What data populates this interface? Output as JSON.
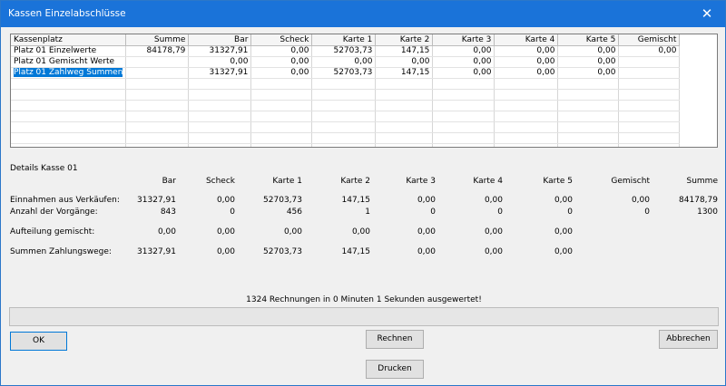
{
  "window": {
    "title": "Kassen Einzelabschlüsse",
    "close_glyph": "✕"
  },
  "grid": {
    "columns": [
      "Kassenplatz",
      "Summe",
      "Bar",
      "Scheck",
      "Karte 1",
      "Karte 2",
      "Karte 3",
      "Karte 4",
      "Karte 5",
      "Gemischt"
    ],
    "rows": [
      [
        "Platz 01 Einzelwerte",
        "84178,79",
        "31327,91",
        "0,00",
        "52703,73",
        "147,15",
        "0,00",
        "0,00",
        "0,00",
        "0,00"
      ],
      [
        "Platz 01 Gemischt Werte",
        "",
        "0,00",
        "0,00",
        "0,00",
        "0,00",
        "0,00",
        "0,00",
        "0,00",
        ""
      ],
      [
        "Platz 01 Zahlweg Summen",
        "",
        "31327,91",
        "0,00",
        "52703,73",
        "147,15",
        "0,00",
        "0,00",
        "0,00",
        ""
      ]
    ],
    "selected_row": 2
  },
  "details": {
    "title": "Details Kasse 01",
    "headers": [
      "Bar",
      "Scheck",
      "Karte 1",
      "Karte 2",
      "Karte 3",
      "Karte 4",
      "Karte 5",
      "Gemischt",
      "Summe"
    ],
    "rows": [
      {
        "label": "Einnahmen aus Verkäufen:",
        "values": [
          "31327,91",
          "0,00",
          "52703,73",
          "147,15",
          "0,00",
          "0,00",
          "0,00",
          "0,00",
          "84178,79"
        ]
      },
      {
        "label": "Anzahl der Vorgänge:",
        "values": [
          "843",
          "0",
          "456",
          "1",
          "0",
          "0",
          "0",
          "0",
          "1300"
        ]
      },
      {
        "label": "Aufteilung gemischt:",
        "values": [
          "0,00",
          "0,00",
          "0,00",
          "0,00",
          "0,00",
          "0,00",
          "0,00",
          "",
          ""
        ]
      },
      {
        "label": "Summen Zahlungswege:",
        "values": [
          "31327,91",
          "0,00",
          "52703,73",
          "147,15",
          "0,00",
          "0,00",
          "0,00",
          "",
          ""
        ]
      }
    ]
  },
  "status_text": "1324 Rechnungen in 0 Minuten 1 Sekunden ausgewertet!",
  "progress_fraction": 0,
  "buttons": {
    "ok": "OK",
    "rechnen": "Rechnen",
    "abbrechen": "Abbrechen",
    "drucken": "Drucken"
  },
  "colors": {
    "titlebar": "#1a73d9",
    "selection": "#0078d7"
  }
}
